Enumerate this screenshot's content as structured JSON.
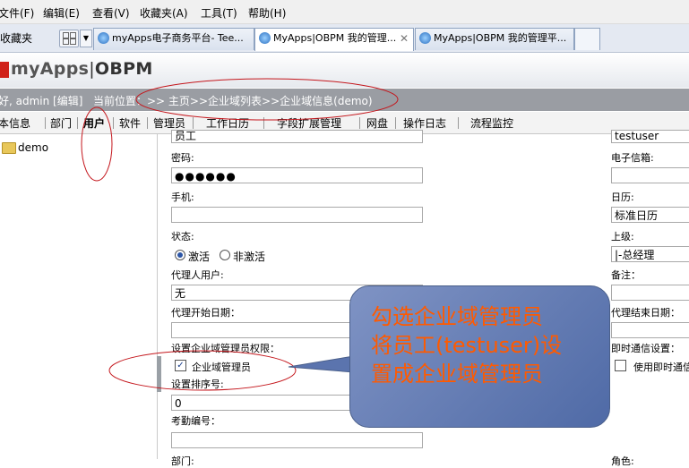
{
  "menu": [
    "文件(F)",
    "编辑(E)",
    "查看(V)",
    "收藏夹(A)",
    "工具(T)",
    "帮助(H)"
  ],
  "toolbar": {
    "favorites_label": "收藏夹",
    "tabs": [
      {
        "label": "myApps电子商务平台- Tee..."
      },
      {
        "label": "MyApps|OBPM 我的管理..."
      },
      {
        "label": "MyApps|OBPM 我的管理平..."
      }
    ]
  },
  "app": {
    "logo_my": "myApps",
    "logo_sep": "|",
    "logo_obpm": "OBPM"
  },
  "status": {
    "greeting": "好, admin [编辑]",
    "breadcrumb_label": "当前位置：",
    "breadcrumb_path": ">> 主页>>企业域列表>>企业域信息(demo)"
  },
  "nav": [
    "本信息",
    "部门",
    "用户",
    "软件",
    "管理员",
    "工作日历",
    "字段扩展管理",
    "网盘",
    "操作日志",
    "流程监控"
  ],
  "tree": {
    "root": "demo"
  },
  "form": {
    "top_value_left": "员工",
    "top_value_right": "testuser",
    "password_label": "密码:",
    "password_value": "●●●●●●",
    "email_label": "电子信箱:",
    "mobile_label": "手机:",
    "calendar_label": "日历:",
    "calendar_value": "标准日历",
    "status_label": "状态:",
    "status_active": "激活",
    "status_inactive": "非激活",
    "superior_label": "上级:",
    "superior_value": "|-总经理",
    "proxy_label": "代理人用户:",
    "proxy_value": "无",
    "remark_label": "备注：",
    "proxy_start_label": "代理开始日期：",
    "proxy_end_label": "代理结束日期：",
    "admin_perm_label": "设置企业域管理员权限：",
    "admin_checkbox_label": "企业域管理员",
    "im_label": "即时通信设置：",
    "im_checkbox_label": "使用即时通信",
    "sort_label": "设置排序号:",
    "sort_value": "0",
    "attendance_label": "考勤编号：",
    "dept_label": "部门:",
    "role_label": "角色:"
  },
  "callout": {
    "line1": "勾选企业域管理员",
    "line2": "将员工(testuser)设",
    "line3": "置成企业域管理员"
  },
  "colors": {
    "annotation": "#c4161c",
    "callout_text": "#ff5a00",
    "callout_bg": "#5b74ae",
    "status_bar": "#9a9da3"
  }
}
